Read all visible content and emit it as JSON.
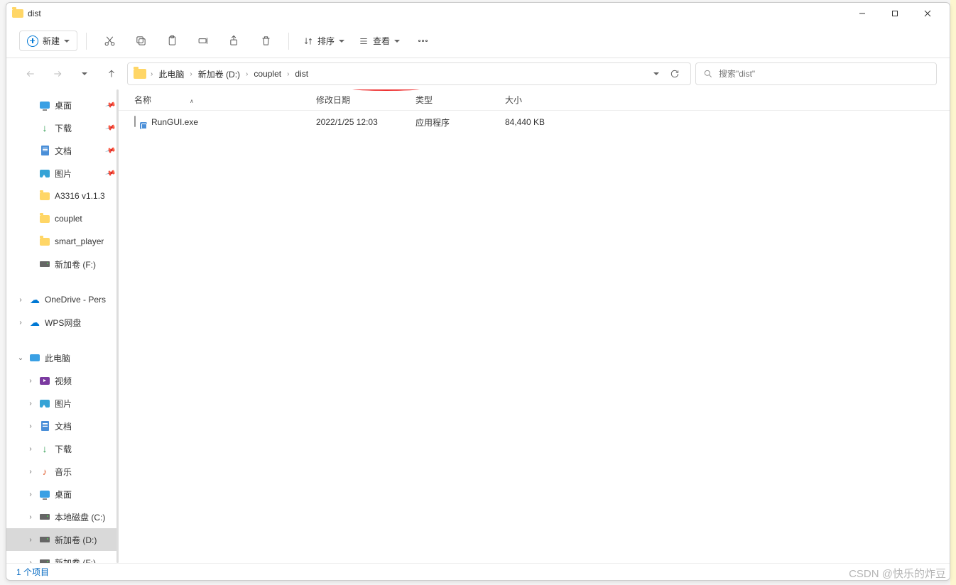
{
  "window": {
    "title": "dist"
  },
  "toolbar": {
    "new_label": "新建",
    "sort_label": "排序",
    "view_label": "查看"
  },
  "breadcrumb": {
    "items": [
      "此电脑",
      "新加卷 (D:)",
      "couplet",
      "dist"
    ]
  },
  "search": {
    "placeholder": "搜索\"dist\""
  },
  "sidebar": {
    "quick": [
      {
        "icon": "desktop",
        "label": "桌面",
        "pin": true
      },
      {
        "icon": "down",
        "label": "下载",
        "pin": true
      },
      {
        "icon": "doc",
        "label": "文档",
        "pin": true
      },
      {
        "icon": "pic",
        "label": "图片",
        "pin": true
      },
      {
        "icon": "folder",
        "label": "A3316 v1.1.3"
      },
      {
        "icon": "folder",
        "label": "couplet"
      },
      {
        "icon": "folder",
        "label": "smart_player"
      },
      {
        "icon": "drive",
        "label": "新加卷 (F:)"
      }
    ],
    "cloud": [
      {
        "icon": "cloud",
        "label": "OneDrive - Pers",
        "expandable": true
      },
      {
        "icon": "cloud",
        "label": "WPS网盘",
        "expandable": true
      }
    ],
    "pc_label": "此电脑",
    "pc_children": [
      {
        "icon": "video",
        "label": "视频"
      },
      {
        "icon": "pic",
        "label": "图片"
      },
      {
        "icon": "doc",
        "label": "文档"
      },
      {
        "icon": "down",
        "label": "下载"
      },
      {
        "icon": "music",
        "label": "音乐"
      },
      {
        "icon": "desktop",
        "label": "桌面"
      },
      {
        "icon": "drive",
        "label": "本地磁盘 (C:)"
      },
      {
        "icon": "drive",
        "label": "新加卷 (D:)",
        "selected": true
      },
      {
        "icon": "drive",
        "label": "新加卷 (F:)"
      }
    ]
  },
  "columns": {
    "name": "名称",
    "date": "修改日期",
    "type": "类型",
    "size": "大小"
  },
  "files": [
    {
      "name": "RunGUI.exe",
      "date": "2022/1/25 12:03",
      "type": "应用程序",
      "size": "84,440 KB"
    }
  ],
  "status": {
    "text": "1 个项目"
  },
  "watermark": "CSDN @快乐的炸豆"
}
